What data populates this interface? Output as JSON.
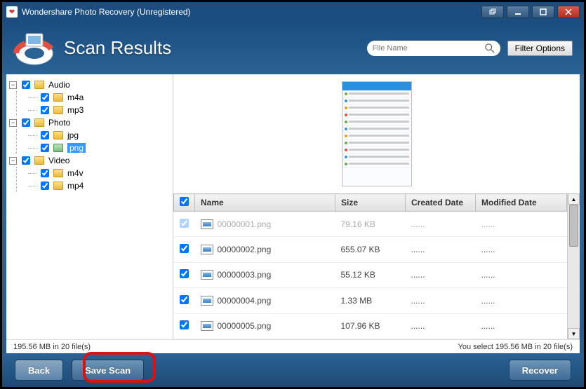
{
  "window": {
    "title": "Wondershare Photo Recovery (Unregistered)"
  },
  "header": {
    "page_title": "Scan Results",
    "search_placeholder": "File Name",
    "filter_label": "Filter Options"
  },
  "tree": {
    "nodes": [
      {
        "label": "Audio",
        "children": [
          {
            "label": "m4a"
          },
          {
            "label": "mp3"
          }
        ]
      },
      {
        "label": "Photo",
        "children": [
          {
            "label": "jpg"
          },
          {
            "label": "png",
            "selected": true
          }
        ]
      },
      {
        "label": "Video",
        "children": [
          {
            "label": "m4v"
          },
          {
            "label": "mp4"
          }
        ]
      }
    ]
  },
  "table": {
    "columns": {
      "name": "Name",
      "size": "Size",
      "created": "Created Date",
      "modified": "Modified Date"
    },
    "rows": [
      {
        "name": "00000001.png",
        "size": "79.16 KB",
        "created": "......",
        "modified": "......",
        "dim": true
      },
      {
        "name": "00000002.png",
        "size": "655.07 KB",
        "created": "......",
        "modified": "......"
      },
      {
        "name": "00000003.png",
        "size": "55.12 KB",
        "created": "......",
        "modified": "......"
      },
      {
        "name": "00000004.png",
        "size": "1.33 MB",
        "created": "......",
        "modified": "......"
      },
      {
        "name": "00000005.png",
        "size": "107.96 KB",
        "created": "......",
        "modified": "......"
      }
    ]
  },
  "status": {
    "left": "195.56 MB in 20 file(s)",
    "right": "You select 195.56 MB in 20 file(s)"
  },
  "footer": {
    "back": "Back",
    "save_scan": "Save Scan",
    "recover": "Recover"
  }
}
